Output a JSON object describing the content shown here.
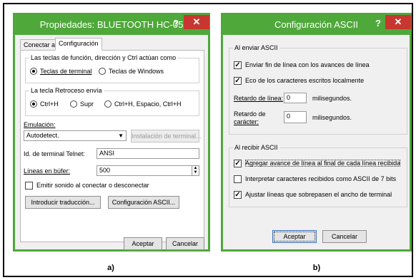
{
  "left_window": {
    "title": "Propiedades: BLUETOOTH HC-05",
    "help": "?",
    "close": "✕",
    "tabs": [
      "Conectar a",
      "Configuración"
    ],
    "group_function_keys": {
      "label": "Las teclas de función, dirección y Ctrl actúan como",
      "options": [
        "Teclas de terminal",
        "Teclas de Windows"
      ],
      "selected": 0
    },
    "group_backspace": {
      "label": "La tecla Retroceso envía",
      "options": [
        "Ctrl+H",
        "Supr",
        "Ctrl+H, Espacio, Ctrl+H"
      ],
      "selected": 0
    },
    "emulation_label": "Emulación:",
    "emulation_value": "Autodetect.",
    "emulation_setup_button": "Instalación de terminal...",
    "terminal_id_label": "Id. de terminal Telnet:",
    "terminal_id_value": "ANSI",
    "buffer_lines_label": "Líneas en búfer:",
    "buffer_lines_value": "500",
    "sound_checkbox_label": "Emitir sonido al conectar o desconectar",
    "sound_checked": false,
    "input_translation_button": "Introducir traducción...",
    "ascii_setup_button": "Configuración ASCII...",
    "ok_button": "Aceptar",
    "cancel_button": "Cancelar"
  },
  "right_window": {
    "title": "Configuración ASCII",
    "help": "?",
    "close": "✕",
    "sending_group_label": "Al enviar ASCII",
    "send_line_ends_label": "Enviar fin de línea con los avances de línea",
    "send_line_ends_checked": true,
    "echo_label": "Eco de los caracteres escritos localmente",
    "echo_checked": true,
    "line_delay_label": "Retardo de línea:",
    "line_delay_value": "0",
    "line_delay_units": "milisegundos.",
    "char_delay_label_1": "Retardo de",
    "char_delay_label_2": "carácter:",
    "char_delay_value": "0",
    "char_delay_units": "milisegundos.",
    "receiving_group_label": "Al recibir ASCII",
    "append_lf_label": "Agregar avance de línea al final de cada línea recibida",
    "append_lf_checked": true,
    "force_7bit_label": "Interpretar caracteres recibidos como ASCII de 7 bits",
    "force_7bit_checked": false,
    "wrap_label": "Ajustar líneas que sobrepasen el ancho de terminal",
    "wrap_checked": true,
    "ok_button": "Aceptar",
    "cancel_button": "Cancelar"
  },
  "captions": {
    "left": "a)",
    "right": "b)"
  }
}
